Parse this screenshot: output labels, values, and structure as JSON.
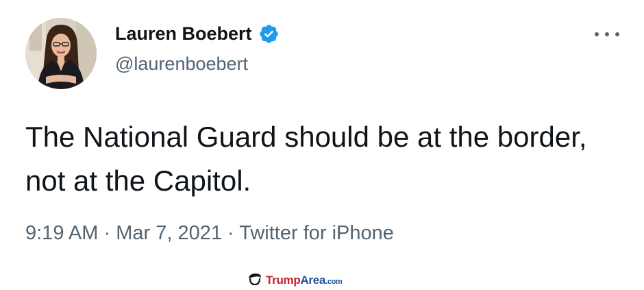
{
  "tweet": {
    "display_name": "Lauren Boebert",
    "handle": "@laurenboebert",
    "verified": true,
    "text": "The National Guard should be at the border, not at the Capitol.",
    "time": "9:19 AM",
    "separator": "·",
    "date": "Mar 7, 2021",
    "source": "Twitter for iPhone"
  },
  "icons": {
    "verified": "verified-badge-icon",
    "more": "more-options-icon",
    "watermark_logo": "trump-hair-logo-icon"
  },
  "watermark": {
    "brand_part1": "Trump",
    "brand_part2": "Area",
    "brand_suffix": ".com"
  },
  "colors": {
    "text": "#0f1419",
    "secondary": "#536471",
    "verified": "#1d9bf0",
    "watermark_red": "#c0262d",
    "watermark_blue": "#1f4e9c"
  }
}
